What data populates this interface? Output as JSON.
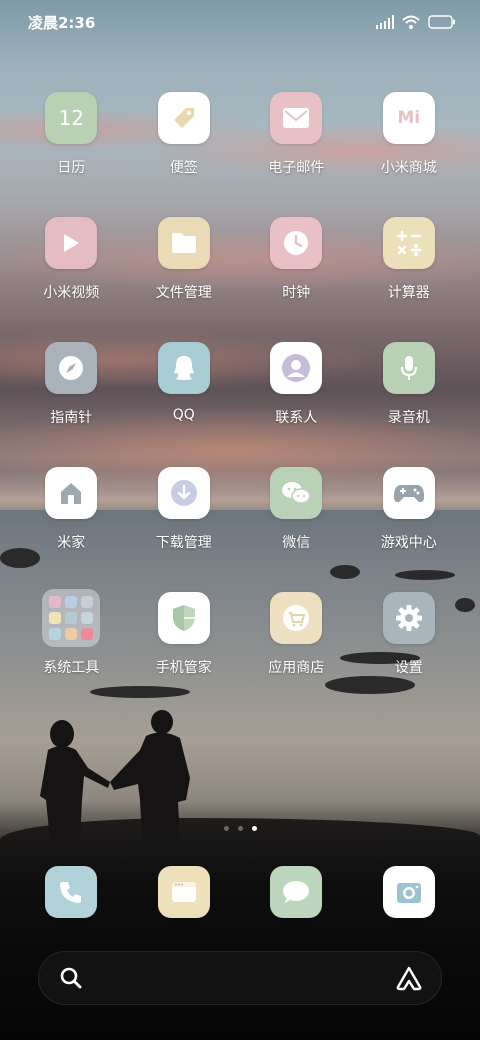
{
  "status_bar": {
    "time": "凌晨2:36",
    "icons": [
      "signal-icon",
      "wifi-icon",
      "battery-icon"
    ]
  },
  "apps": [
    {
      "label": "日历",
      "icon": "calendar-icon",
      "icon_text": "12",
      "bg": "#b7d1b1"
    },
    {
      "label": "便签",
      "icon": "notes-tag-icon",
      "bg": "#ffffff"
    },
    {
      "label": "电子邮件",
      "icon": "mail-icon",
      "bg": "#e8c1c6"
    },
    {
      "label": "小米商城",
      "icon": "mi-store-icon",
      "icon_text": "Mi",
      "bg": "#ffffff"
    },
    {
      "label": "小米视频",
      "icon": "video-play-icon",
      "bg": "#e6bcc3"
    },
    {
      "label": "文件管理",
      "icon": "folder-icon",
      "bg": "#eadbb6"
    },
    {
      "label": "时钟",
      "icon": "clock-icon",
      "bg": "#e8c0c6"
    },
    {
      "label": "计算器",
      "icon": "calculator-icon",
      "bg": "#ebe0ba"
    },
    {
      "label": "指南针",
      "icon": "compass-icon",
      "bg": "#a9b2b9"
    },
    {
      "label": "QQ",
      "icon": "qq-penguin-icon",
      "bg": "#a7ccd3"
    },
    {
      "label": "联系人",
      "icon": "contact-icon",
      "bg": "#ffffff"
    },
    {
      "label": "录音机",
      "icon": "microphone-icon",
      "bg": "#b8d1b5"
    },
    {
      "label": "米家",
      "icon": "home-icon",
      "bg": "#ffffff"
    },
    {
      "label": "下载管理",
      "icon": "download-icon",
      "bg": "#ffffff"
    },
    {
      "label": "微信",
      "icon": "wechat-icon",
      "bg": "#b9d2b7"
    },
    {
      "label": "游戏中心",
      "icon": "gamepad-icon",
      "bg": "#ffffff"
    },
    {
      "label": "系统工具",
      "icon": "folder-group-icon",
      "folder": true
    },
    {
      "label": "手机管家",
      "icon": "shield-icon",
      "bg": "#ffffff"
    },
    {
      "label": "应用商店",
      "icon": "shopping-cart-icon",
      "bg": "#eedfc0"
    },
    {
      "label": "设置",
      "icon": "gear-icon",
      "bg": "#a9b5bc"
    }
  ],
  "page_indicator": {
    "count": 3,
    "active": 3
  },
  "dock": [
    {
      "icon": "phone-icon",
      "bg": "#b2d2da"
    },
    {
      "icon": "browser-icon",
      "bg": "#ede0bb"
    },
    {
      "icon": "message-icon",
      "bg": "#bcd6bd"
    },
    {
      "icon": "camera-icon",
      "bg": "#ffffff"
    }
  ],
  "search": {
    "placeholder": "",
    "left_icon": "search-icon",
    "right_icon": "assistant-icon"
  },
  "colors": {
    "icon_glyph_gray": "#a6adb5",
    "icon_glyph_white": "#ffffff"
  }
}
